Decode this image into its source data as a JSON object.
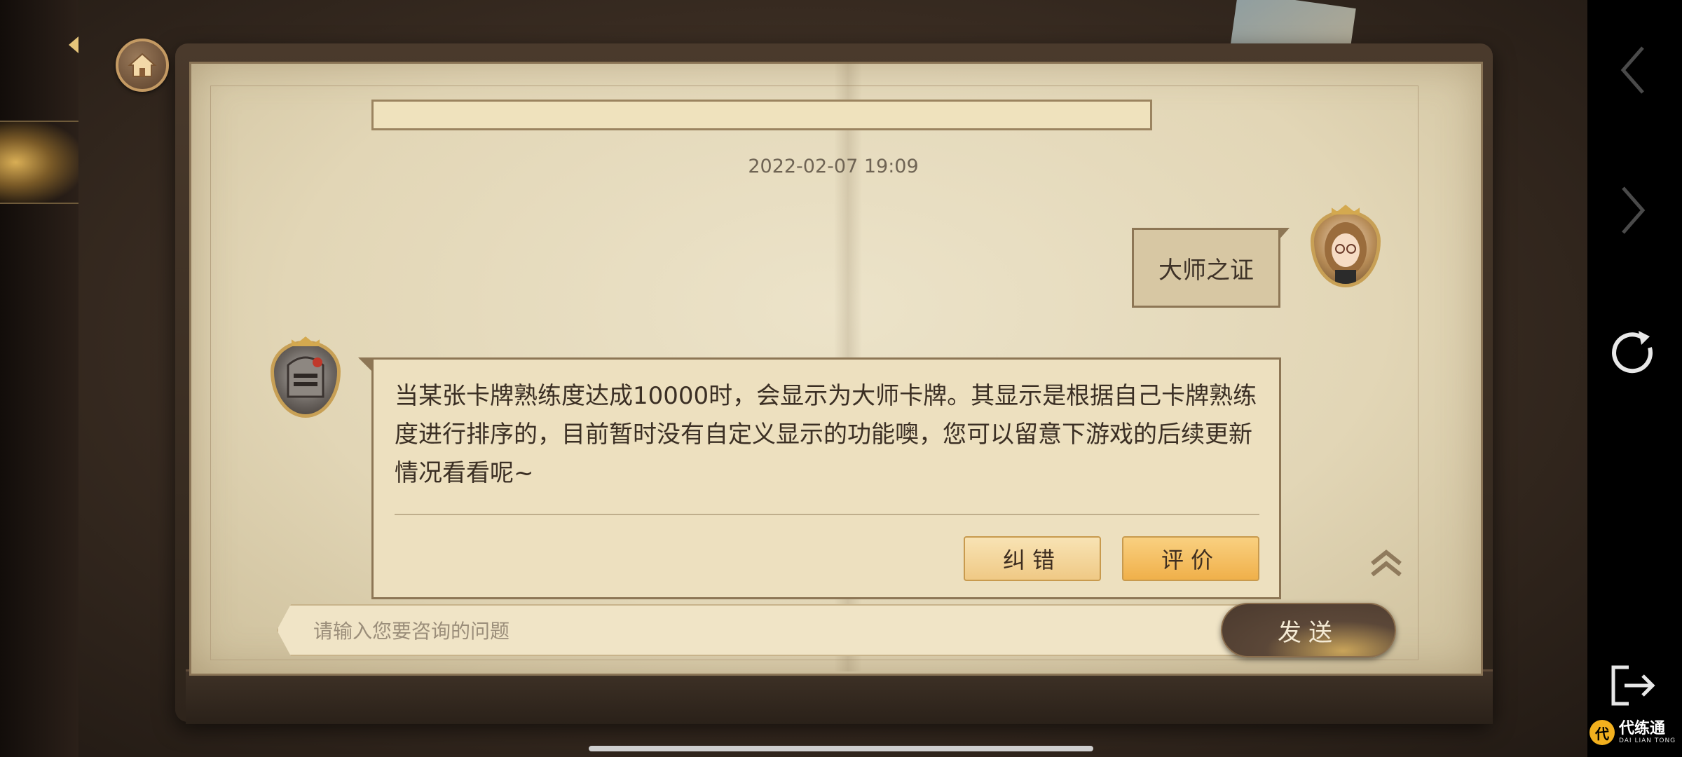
{
  "chat": {
    "timestamp": "2022-02-07 19:09",
    "user_message": "大师之证",
    "reply_text": "当某张卡牌熟练度达成10000时，会显示为大师卡牌。其显示是根据自己卡牌熟练度进行排序的，目前暂时没有自定义显示的功能噢，您可以留意下游戏的后续更新情况看看呢~",
    "correct_label": "纠错",
    "rate_label": "评价"
  },
  "input": {
    "placeholder": "请输入您要咨询的问题",
    "send_label": "发送"
  },
  "watermark": {
    "logo_char": "代",
    "main": "代练通",
    "sub": "DAI LIAN TONG"
  },
  "colors": {
    "accent": "#f0b04a",
    "page": "#e2d6b6",
    "frame": "#4a3a2c"
  }
}
